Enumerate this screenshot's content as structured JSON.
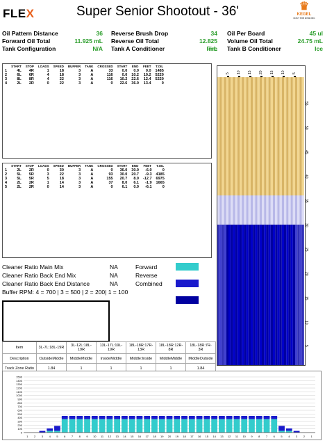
{
  "header": {
    "logo_text": "FLE",
    "logo_x": "X",
    "title": "Super Senior Shootout - 36'",
    "brand": "KEGEL",
    "brand_sub": "BUILT FOR BOWLING"
  },
  "stats": [
    {
      "l1": "Oil Pattern Distance",
      "v1": "36",
      "l2": "Reverse Brush Drop",
      "v2": "34",
      "l3": "Oil Per Board",
      "v3": "45 ul"
    },
    {
      "l1": "Forward Oil Total",
      "v1": "11.925 mL",
      "l2": "Reverse Oil Total",
      "v2": "12.825 mL",
      "l3": "Volume Oil Total",
      "v3": "24.75 mL"
    },
    {
      "l1": "Tank Configuration",
      "v1": "N/A",
      "l2": "Tank A Conditioner",
      "v2": "Fire",
      "l3": "Tank B Conditioner",
      "v3": "Ice"
    }
  ],
  "table_headers": [
    "START",
    "STOP",
    "LOADS",
    "SPEED",
    "BUFFER",
    "TANK",
    "CROSSED",
    "START",
    "END",
    "FEET",
    "T.OIL"
  ],
  "forward_rows": [
    [
      "1",
      "4L",
      "4R",
      "1",
      "18",
      "3",
      "A",
      "33",
      "0.0",
      "0.0",
      "0.0",
      "1485"
    ],
    [
      "2",
      "6L",
      "6R",
      "4",
      "18",
      "3",
      "A",
      "116",
      "0.0",
      "10.2",
      "10.2",
      "5220"
    ],
    [
      "3",
      "8L",
      "8R",
      "4",
      "22",
      "3",
      "A",
      "116",
      "10.2",
      "22.6",
      "12.4",
      "5220"
    ],
    [
      "4",
      "2L",
      "2R",
      "0",
      "22",
      "3",
      "A",
      "0",
      "22.6",
      "36.0",
      "13.4",
      "0"
    ]
  ],
  "reverse_rows": [
    [
      "1",
      "2L",
      "2R",
      "0",
      "30",
      "3",
      "A",
      "0",
      "36.0",
      "30.0",
      "-6.0",
      "0"
    ],
    [
      "2",
      "5L",
      "5R",
      "3",
      "22",
      "3",
      "A",
      "93",
      "30.0",
      "20.7",
      "-9.3",
      "4185"
    ],
    [
      "3",
      "5L",
      "5R",
      "5",
      "18",
      "3",
      "A",
      "155",
      "20.7",
      "8.0",
      "-12.7",
      "6975"
    ],
    [
      "4",
      "2L",
      "2R",
      "1",
      "14",
      "3",
      "A",
      "37",
      "8.0",
      "6.1",
      "-1.9",
      "1665"
    ],
    [
      "5",
      "2L",
      "2R",
      "0",
      "14",
      "3",
      "A",
      "0",
      "6.1",
      "0.0",
      "-6.1",
      "0"
    ]
  ],
  "legend": {
    "rows": [
      {
        "label": "Cleaner Ratio Main Mix",
        "val": "NA",
        "kind": "Forward",
        "color": "#33cccc"
      },
      {
        "label": "Cleaner Ratio Back End Mix",
        "val": "NA",
        "kind": "Reverse",
        "color": "#1a1acc"
      },
      {
        "label": "Cleaner Ratio Back End Distance",
        "val": "NA",
        "kind": "Combined",
        "color": "#0000a0"
      }
    ],
    "buffer": "Buffer RPM: 4 = 700 | 3 = 500 | 2 = 200| 1 = 100"
  },
  "zone": {
    "headers": [
      "Item",
      "3L-7L:18L-19R",
      "3L-12L:18L-19R",
      "13L-17L:19L-19R",
      "18L-18R:17R-13R",
      "18L-18R:12R-8R",
      "18L-18R:7R-3R"
    ],
    "desc": [
      "Description",
      "OutsideMiddle",
      "MiddleMiddle",
      "InsideMiddle",
      "Middle:Inside",
      "MiddleMiddle",
      "MiddleOutside"
    ],
    "ratio": [
      "Track Zone Ratio",
      "1.84",
      "1",
      "1",
      "1",
      "1",
      "1.84"
    ]
  },
  "lane": {
    "feet_labels": [
      "55",
      "50",
      "45",
      "40",
      "35",
      "30",
      "25",
      "20",
      "15",
      "10",
      "5"
    ],
    "board_labels": [
      "5",
      "10",
      "15",
      "20",
      "15",
      "10",
      "5"
    ]
  },
  "chart_data": {
    "type": "bar",
    "categories": [
      "1",
      "2",
      "3",
      "4",
      "5",
      "6",
      "7",
      "8",
      "9",
      "10",
      "11",
      "12",
      "13",
      "14",
      "15",
      "16",
      "17",
      "18",
      "19",
      "20",
      "19",
      "18",
      "17",
      "16",
      "15",
      "14",
      "13",
      "12",
      "11",
      "10",
      "9",
      "8",
      "7",
      "6",
      "5",
      "4",
      "3",
      "2",
      "1"
    ],
    "ylim": [
      0,
      1500
    ],
    "yticks": [
      0,
      100,
      200,
      300,
      400,
      500,
      600,
      700,
      800,
      900,
      1000,
      1100,
      1200,
      1300,
      1400,
      1500
    ],
    "series": [
      {
        "color": "#33cccc",
        "values": [
          0,
          0,
          0,
          45,
          45,
          360,
          360,
          360,
          360,
          360,
          360,
          360,
          360,
          360,
          360,
          360,
          360,
          360,
          360,
          360,
          360,
          360,
          360,
          360,
          360,
          360,
          360,
          360,
          360,
          360,
          360,
          360,
          360,
          360,
          45,
          45,
          0,
          0,
          0
        ]
      },
      {
        "color": "#1a1acc",
        "values": [
          0,
          0,
          45,
          110,
          180,
          450,
          450,
          450,
          450,
          450,
          450,
          450,
          450,
          450,
          450,
          450,
          450,
          450,
          450,
          450,
          450,
          450,
          450,
          450,
          450,
          450,
          450,
          450,
          450,
          450,
          450,
          450,
          450,
          450,
          180,
          110,
          45,
          0,
          0
        ]
      }
    ]
  }
}
